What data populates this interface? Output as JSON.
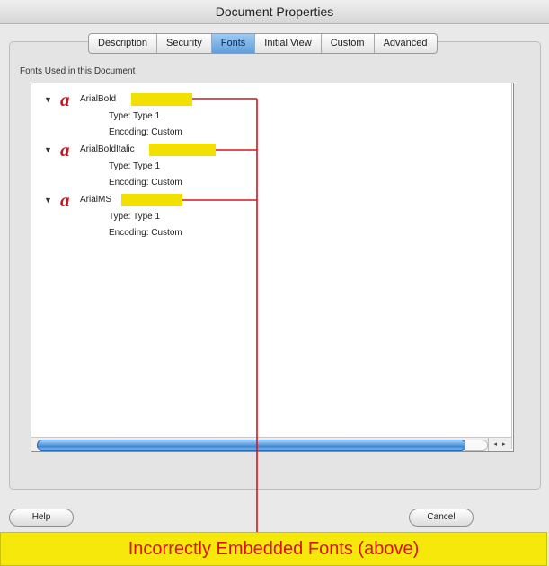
{
  "window": {
    "title": "Document Properties"
  },
  "tabs": [
    {
      "label": "Description",
      "active": false
    },
    {
      "label": "Security",
      "active": false
    },
    {
      "label": "Fonts",
      "active": true
    },
    {
      "label": "Initial View",
      "active": false
    },
    {
      "label": "Custom",
      "active": false
    },
    {
      "label": "Advanced",
      "active": false
    }
  ],
  "fonts_section": {
    "label": "Fonts Used in this Document",
    "fonts": [
      {
        "name": "ArialBold",
        "type": "Type: Type 1",
        "encoding": "Encoding: Custom"
      },
      {
        "name": "ArialBoldItalic",
        "type": "Type: Type 1",
        "encoding": "Encoding: Custom"
      },
      {
        "name": "ArialMS",
        "type": "Type: Type 1",
        "encoding": "Encoding: Custom"
      }
    ]
  },
  "scroll": {
    "arrows": "◂ ▸"
  },
  "buttons": {
    "help": "Help",
    "cancel": "Cancel"
  },
  "annotation": {
    "text": "Incorrectly Embedded Fonts (above)",
    "highlight_color": "#f2e100",
    "line_color": "#d7131d"
  },
  "icons": {
    "font": "acrobat-font-icon",
    "expand": "disclosure-triangle-icon"
  }
}
